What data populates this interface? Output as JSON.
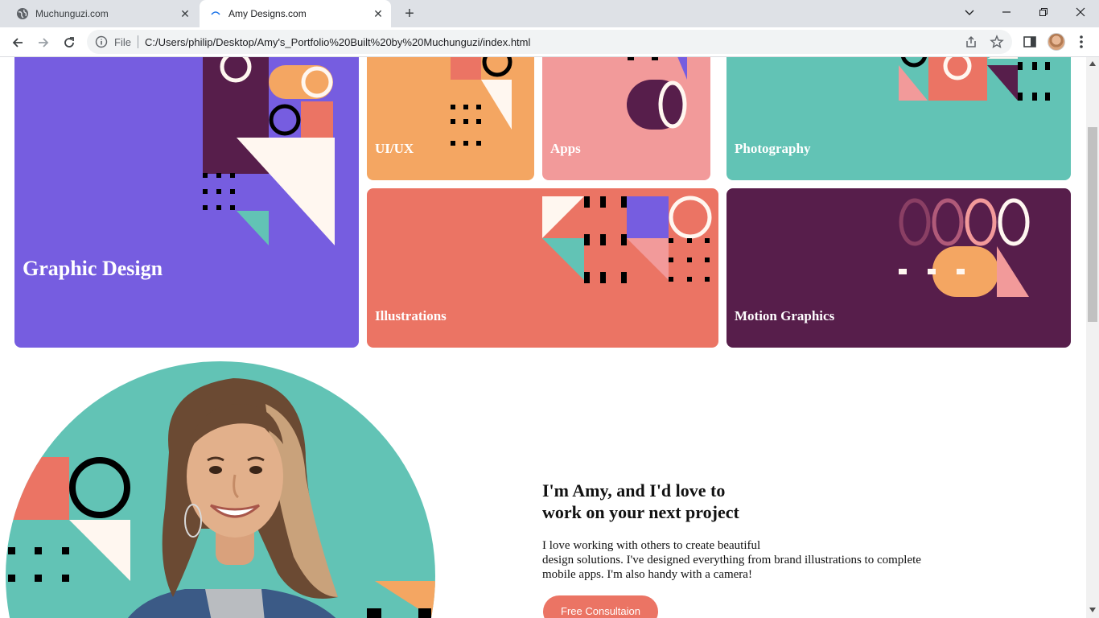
{
  "browser": {
    "tabs": [
      {
        "title": "Muchunguzi.com",
        "active": false
      },
      {
        "title": "Amy Designs.com",
        "active": true
      }
    ],
    "address": {
      "scheme_label": "File",
      "url": "C:/Users/philip/Desktop/Amy's_Portfolio%20Built%20by%20Muchunguzi/index.html"
    }
  },
  "portfolio": {
    "categories": [
      {
        "label": "Graphic Design",
        "color": "#765de0"
      },
      {
        "label": "UI/UX",
        "color": "#f4a662"
      },
      {
        "label": "Apps",
        "color": "#f29a9a"
      },
      {
        "label": "Photography",
        "color": "#62c3b5"
      },
      {
        "label": "Illustrations",
        "color": "#eb7464"
      },
      {
        "label": "Motion Graphics",
        "color": "#571e4b"
      }
    ]
  },
  "about": {
    "heading_line1": "I'm Amy, and I'd love to",
    "heading_line2": "work on your next project",
    "text_line1": "I love working with others to create beautiful",
    "text_line2": "design solutions. I've designed everything from brand illustrations to complete",
    "text_line3": "mobile apps. I'm also handy with a camera!",
    "cta_label": "Free Consultaion"
  },
  "colors": {
    "purple": "#765de0",
    "orange": "#f4a662",
    "pink": "#f29a9a",
    "teal": "#62c3b5",
    "coral": "#eb7464",
    "plum": "#571e4b",
    "cream": "#fff7f0"
  }
}
